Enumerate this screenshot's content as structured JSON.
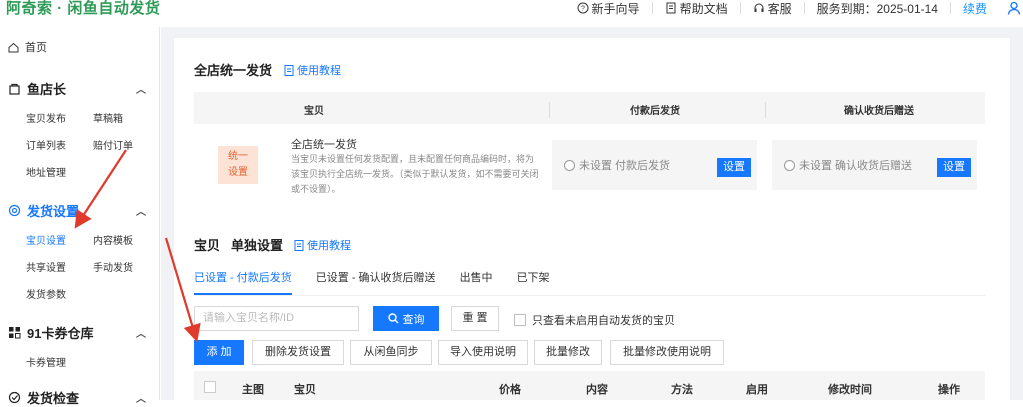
{
  "app": {
    "brand": "阿奇索 · 闲鱼自动发货"
  },
  "topbar": {
    "guide": "新手向导",
    "help": "帮助文档",
    "service": "客服",
    "expiry": "服务到期：2025-01-14",
    "renew": "续费"
  },
  "sidebar": {
    "home": "首页",
    "groups": [
      {
        "title": "鱼店长",
        "items": [
          "宝贝发布",
          "草稿箱",
          "订单列表",
          "赔付订单",
          "地址管理"
        ]
      },
      {
        "title": "发货设置",
        "items": [
          "宝贝设置",
          "内容模板",
          "共享设置",
          "手动发货",
          "发货参数"
        ]
      },
      {
        "title": "91卡券仓库",
        "items": [
          "卡券管理"
        ]
      },
      {
        "title": "发货检查",
        "items": []
      }
    ]
  },
  "store_section": {
    "title": "全店统一发货",
    "tutorial": "使用教程",
    "columns": [
      "宝贝",
      "付款后发货",
      "确认收货后赠送"
    ],
    "badge": "统一设置",
    "badge_line1": "统一",
    "badge_line2": "设置",
    "desc_title": "全店统一发货",
    "desc_text": "当宝贝未设置任何发货配置，且未配置任何商品编码时，将为该宝贝执行全店统一发货。（类似于默认发货，如不需要可关闭或不设置）。",
    "pay_status": "未设置 付款后发货",
    "confirm_status": "未设置 确认收货后赠送",
    "set_label": "设置"
  },
  "item_section": {
    "title_a": "宝贝",
    "title_b": "单独设置",
    "tutorial": "使用教程",
    "tabs": [
      "已设置 - 付款后发货",
      "已设置 - 确认收货后赠送",
      "出售中",
      "已下架"
    ],
    "active_tab": 0,
    "search_placeholder": "请输入宝贝名称/ID",
    "query_label": "查询",
    "reset_label": "重 置",
    "only_disabled_label": "只查看未启用自动发货的宝贝",
    "actions": [
      "添 加",
      "删除发货设置",
      "从闲鱼同步",
      "导入使用说明",
      "批量修改",
      "批量修改使用说明"
    ],
    "columns": [
      "主图",
      "宝贝",
      "价格",
      "内容",
      "方法",
      "启用",
      "修改时间",
      "操作"
    ]
  },
  "colors": {
    "brand": "#2d9b56",
    "accent": "#1677ff",
    "badge_bg": "#fde3d6",
    "badge_text": "#e0622d",
    "arrow": "#e03a2c"
  }
}
